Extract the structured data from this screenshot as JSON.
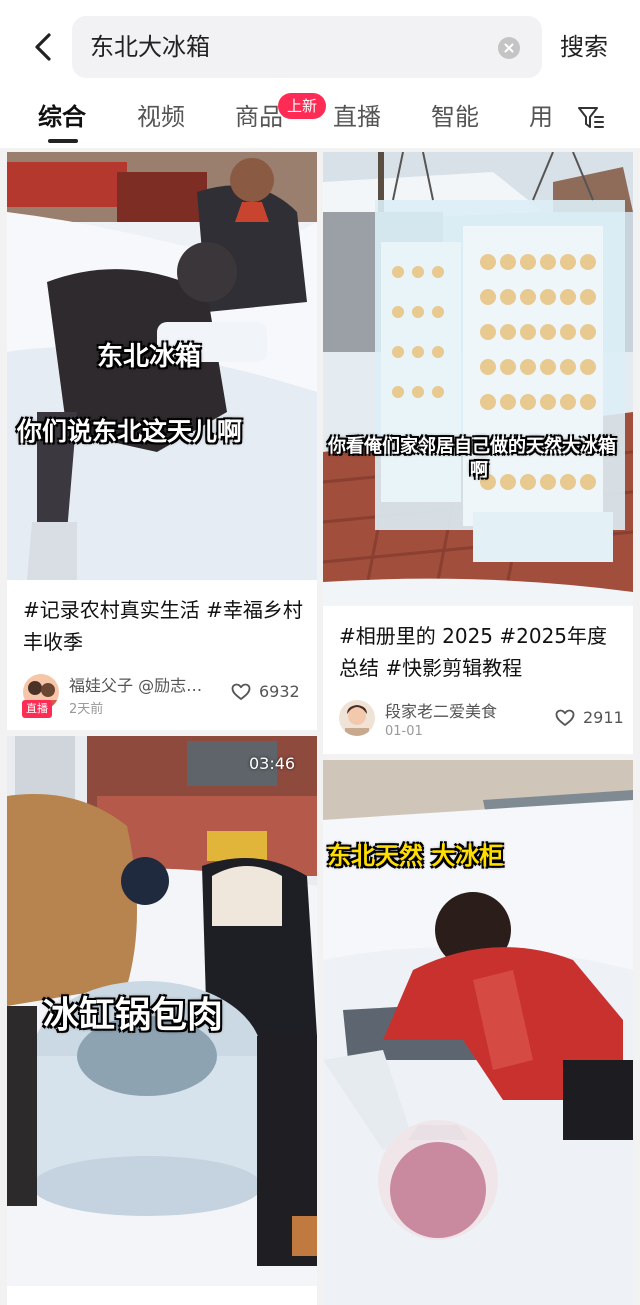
{
  "search": {
    "query": "东北大冰箱",
    "button_label": "搜索"
  },
  "tabs": [
    {
      "label": "综合",
      "active": true
    },
    {
      "label": "视频"
    },
    {
      "label": "商品",
      "badge": "上新"
    },
    {
      "label": "直播"
    },
    {
      "label": "智能"
    },
    {
      "label": "用"
    }
  ],
  "icons": {
    "back": "back-arrow-icon",
    "clear": "clear-icon",
    "filter": "filter-icon",
    "like": "heart-icon"
  },
  "colors": {
    "accent": "#fe2c55",
    "background": "#f2f2f2"
  },
  "cards": [
    {
      "overlay_lines": [
        "东北冰箱",
        "你们说东北这天儿啊"
      ],
      "caption": "#记录农村真实生活 #幸福乡村丰收季",
      "author": "福娃父子 @励志…",
      "date": "2天前",
      "likes": "6932",
      "live_label": "直播"
    },
    {
      "overlay_lines": [
        "你看俺们家邻居自己做的天然大冰箱",
        "啊"
      ],
      "caption": "#相册里的 2025 #2025年度总结 #快影剪辑教程",
      "author": "段家老二爱美食",
      "date": "01-01",
      "likes": "2911"
    },
    {
      "duration": "03:46",
      "overlay_lines": [
        "冰缸锅包肉"
      ]
    },
    {
      "overlay_lines": [
        "东北天然 大冰柜"
      ]
    }
  ]
}
